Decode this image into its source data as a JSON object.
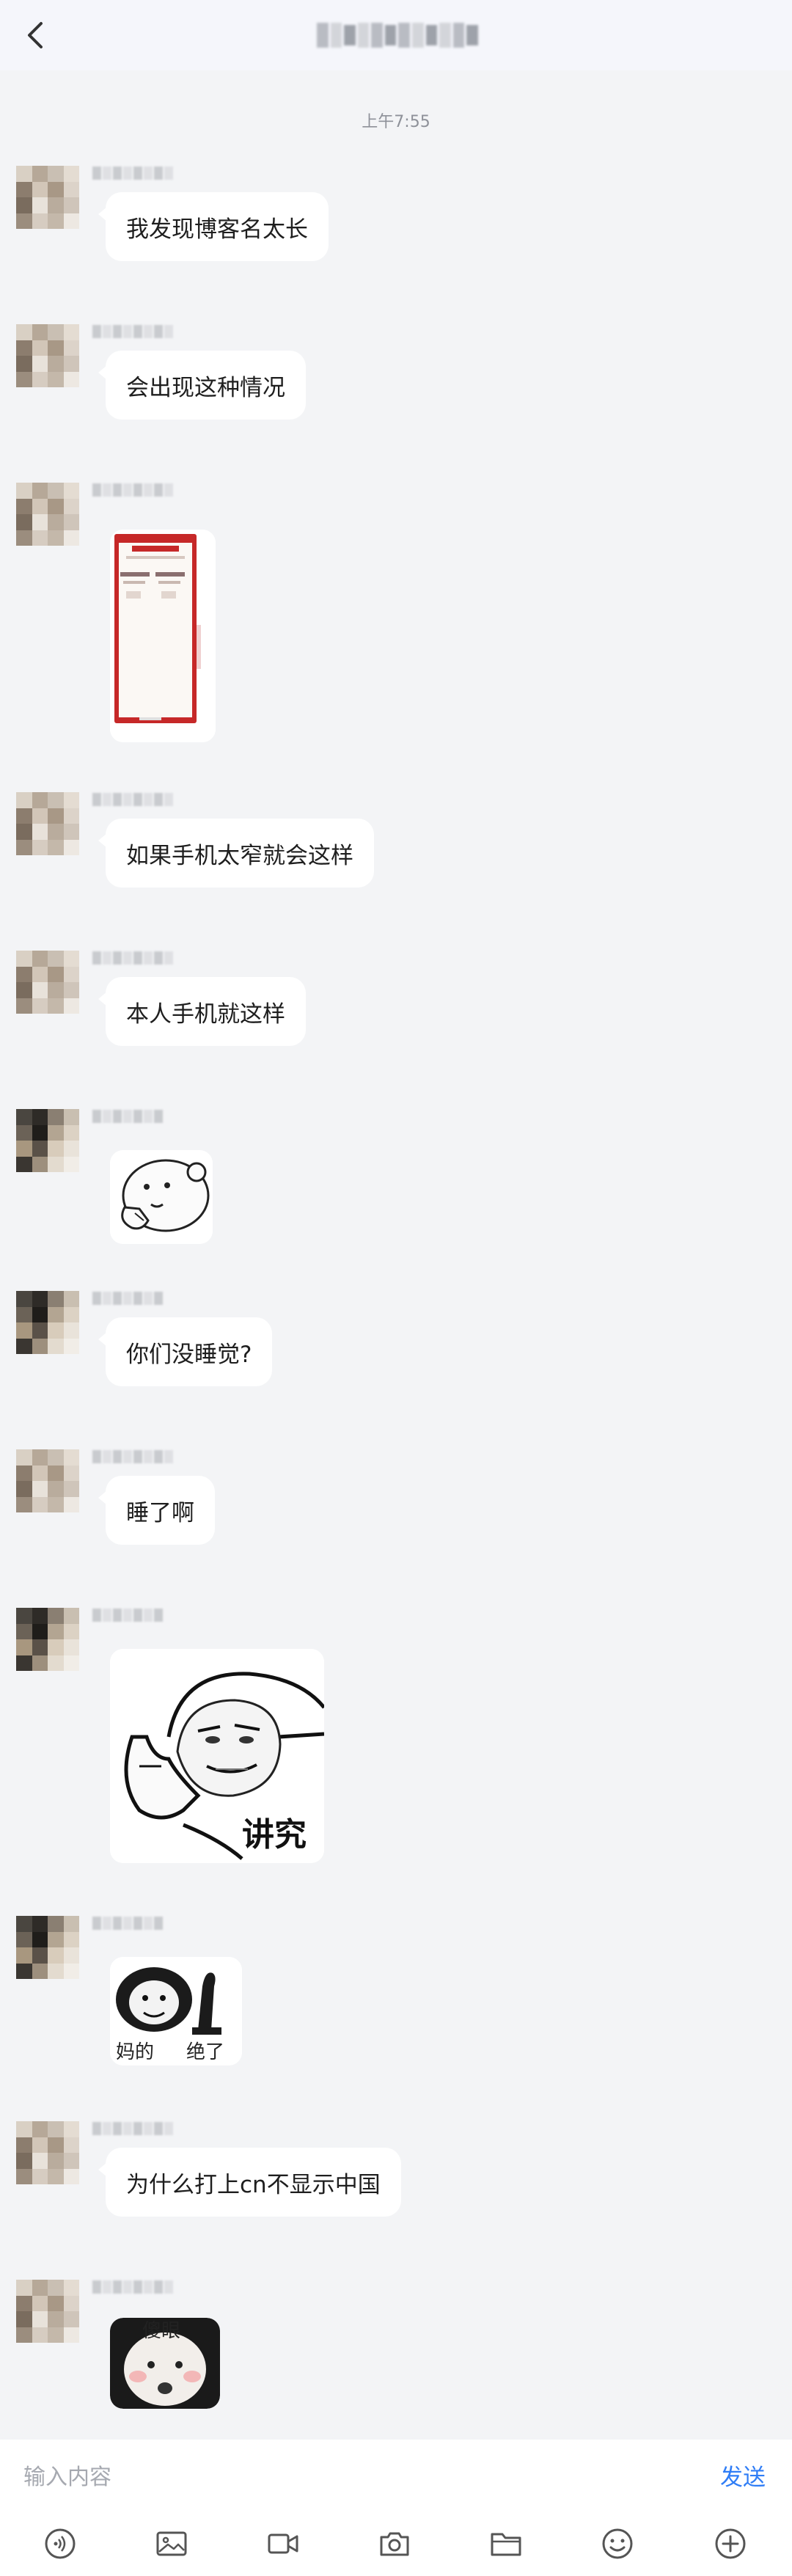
{
  "header": {
    "back_icon": "chevron-left-icon",
    "title": ""
  },
  "timestamp": "上午7:55",
  "messages": [
    {
      "type": "text",
      "text": "我发现博客名太长"
    },
    {
      "type": "text",
      "text": "会出现这种情况"
    },
    {
      "type": "image",
      "description_icon": "phone-screenshot"
    },
    {
      "type": "text",
      "text": "如果手机太窄就会这样"
    },
    {
      "type": "text",
      "text": "本人手机就这样"
    },
    {
      "type": "sticker",
      "icon": "thinking-face-sticker"
    },
    {
      "type": "text",
      "text": "你们没睡觉?"
    },
    {
      "type": "text",
      "text": "睡了啊"
    },
    {
      "type": "sticker",
      "icon": "thumbs-up-face-sticker",
      "caption": "讲究"
    },
    {
      "type": "sticker",
      "icon": "panda-face-sticker",
      "caption_left": "妈的",
      "caption_right": "绝了"
    },
    {
      "type": "text",
      "text": "为什么打上cn不显示中国"
    },
    {
      "type": "sticker",
      "icon": "shocked-face-sticker",
      "caption": "傻眼"
    }
  ],
  "input": {
    "placeholder": "输入内容",
    "value": "",
    "send_label": "发送"
  },
  "toolbar": {
    "icons": [
      "voice-icon",
      "image-icon",
      "video-icon",
      "camera-icon",
      "folder-icon",
      "emoji-icon",
      "plus-icon"
    ]
  },
  "colors": {
    "background": "#f3f4f6",
    "bubble": "#ffffff",
    "send": "#2f7df6",
    "screenshot_red": "#c62828"
  }
}
